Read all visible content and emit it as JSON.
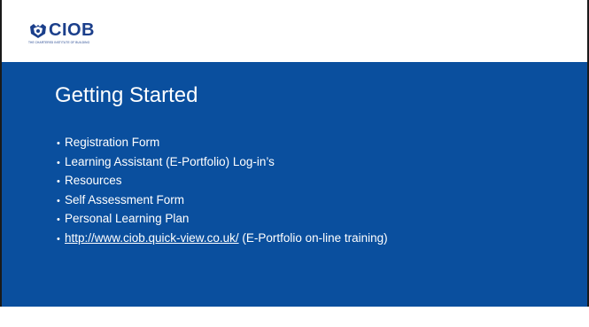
{
  "header": {
    "logo_text": "CIOB",
    "logo_subtitle": "THE CHARTERED INSTITUTE OF BUILDING"
  },
  "main": {
    "title": "Getting Started",
    "bullet_char": "•",
    "items": [
      {
        "text": "Registration Form"
      },
      {
        "text": "Learning Assistant (E-Portfolio) Log-in’s"
      },
      {
        "text": "Resources"
      },
      {
        "text": "Self Assessment Form"
      },
      {
        "text": "Personal Learning Plan"
      },
      {
        "link_text": "http://www.ciob.quick-view.co.uk/",
        "text": " (E-Portfolio on-line training)"
      }
    ]
  },
  "colors": {
    "background_blue": "#0a4f9e",
    "logo_blue": "#1b3f8b",
    "text": "#ffffff"
  }
}
